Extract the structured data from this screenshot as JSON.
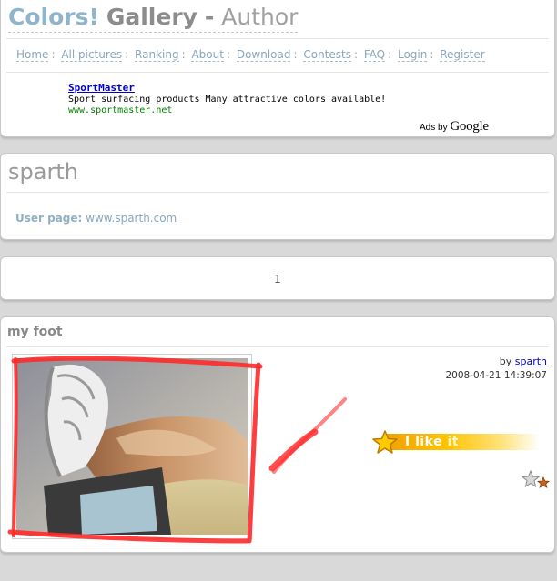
{
  "header": {
    "title_part1": "Colors!",
    "title_part2": "Gallery",
    "title_part3": "-",
    "title_part4": "Author"
  },
  "nav": {
    "items": [
      {
        "label": "Home"
      },
      {
        "label": "All pictures"
      },
      {
        "label": "Ranking"
      },
      {
        "label": "About"
      },
      {
        "label": "Download"
      },
      {
        "label": "Contests"
      },
      {
        "label": "FAQ"
      },
      {
        "label": "Login"
      },
      {
        "label": "Register"
      }
    ],
    "separator": ":"
  },
  "ad": {
    "title": "SportMaster",
    "text": "Sport surfacing products Many attractive colors available!",
    "url": "www.sportmaster.net",
    "ads_by": "Ads by",
    "google": "Google"
  },
  "author": {
    "name": "sparth",
    "user_page_label": "User page:",
    "user_page_link": "www.sparth.com"
  },
  "pagination": {
    "current_page": "1"
  },
  "picture": {
    "title": "my foot",
    "by_label": "by",
    "author": "sparth",
    "date": "2008-04-21 14:39:07",
    "like_label_1": "I like",
    "like_label_2": "it"
  },
  "colors": {
    "title_blue": "#8fb5cc",
    "link_blue": "#8aa7bb",
    "ad_link": "#0000cc",
    "ad_url": "#008000",
    "like_yellow": "#ffc400",
    "scribble_red": "#ff2020"
  },
  "icons": {
    "like_star": "star-icon",
    "favorite": "favorite-stars-icon"
  }
}
